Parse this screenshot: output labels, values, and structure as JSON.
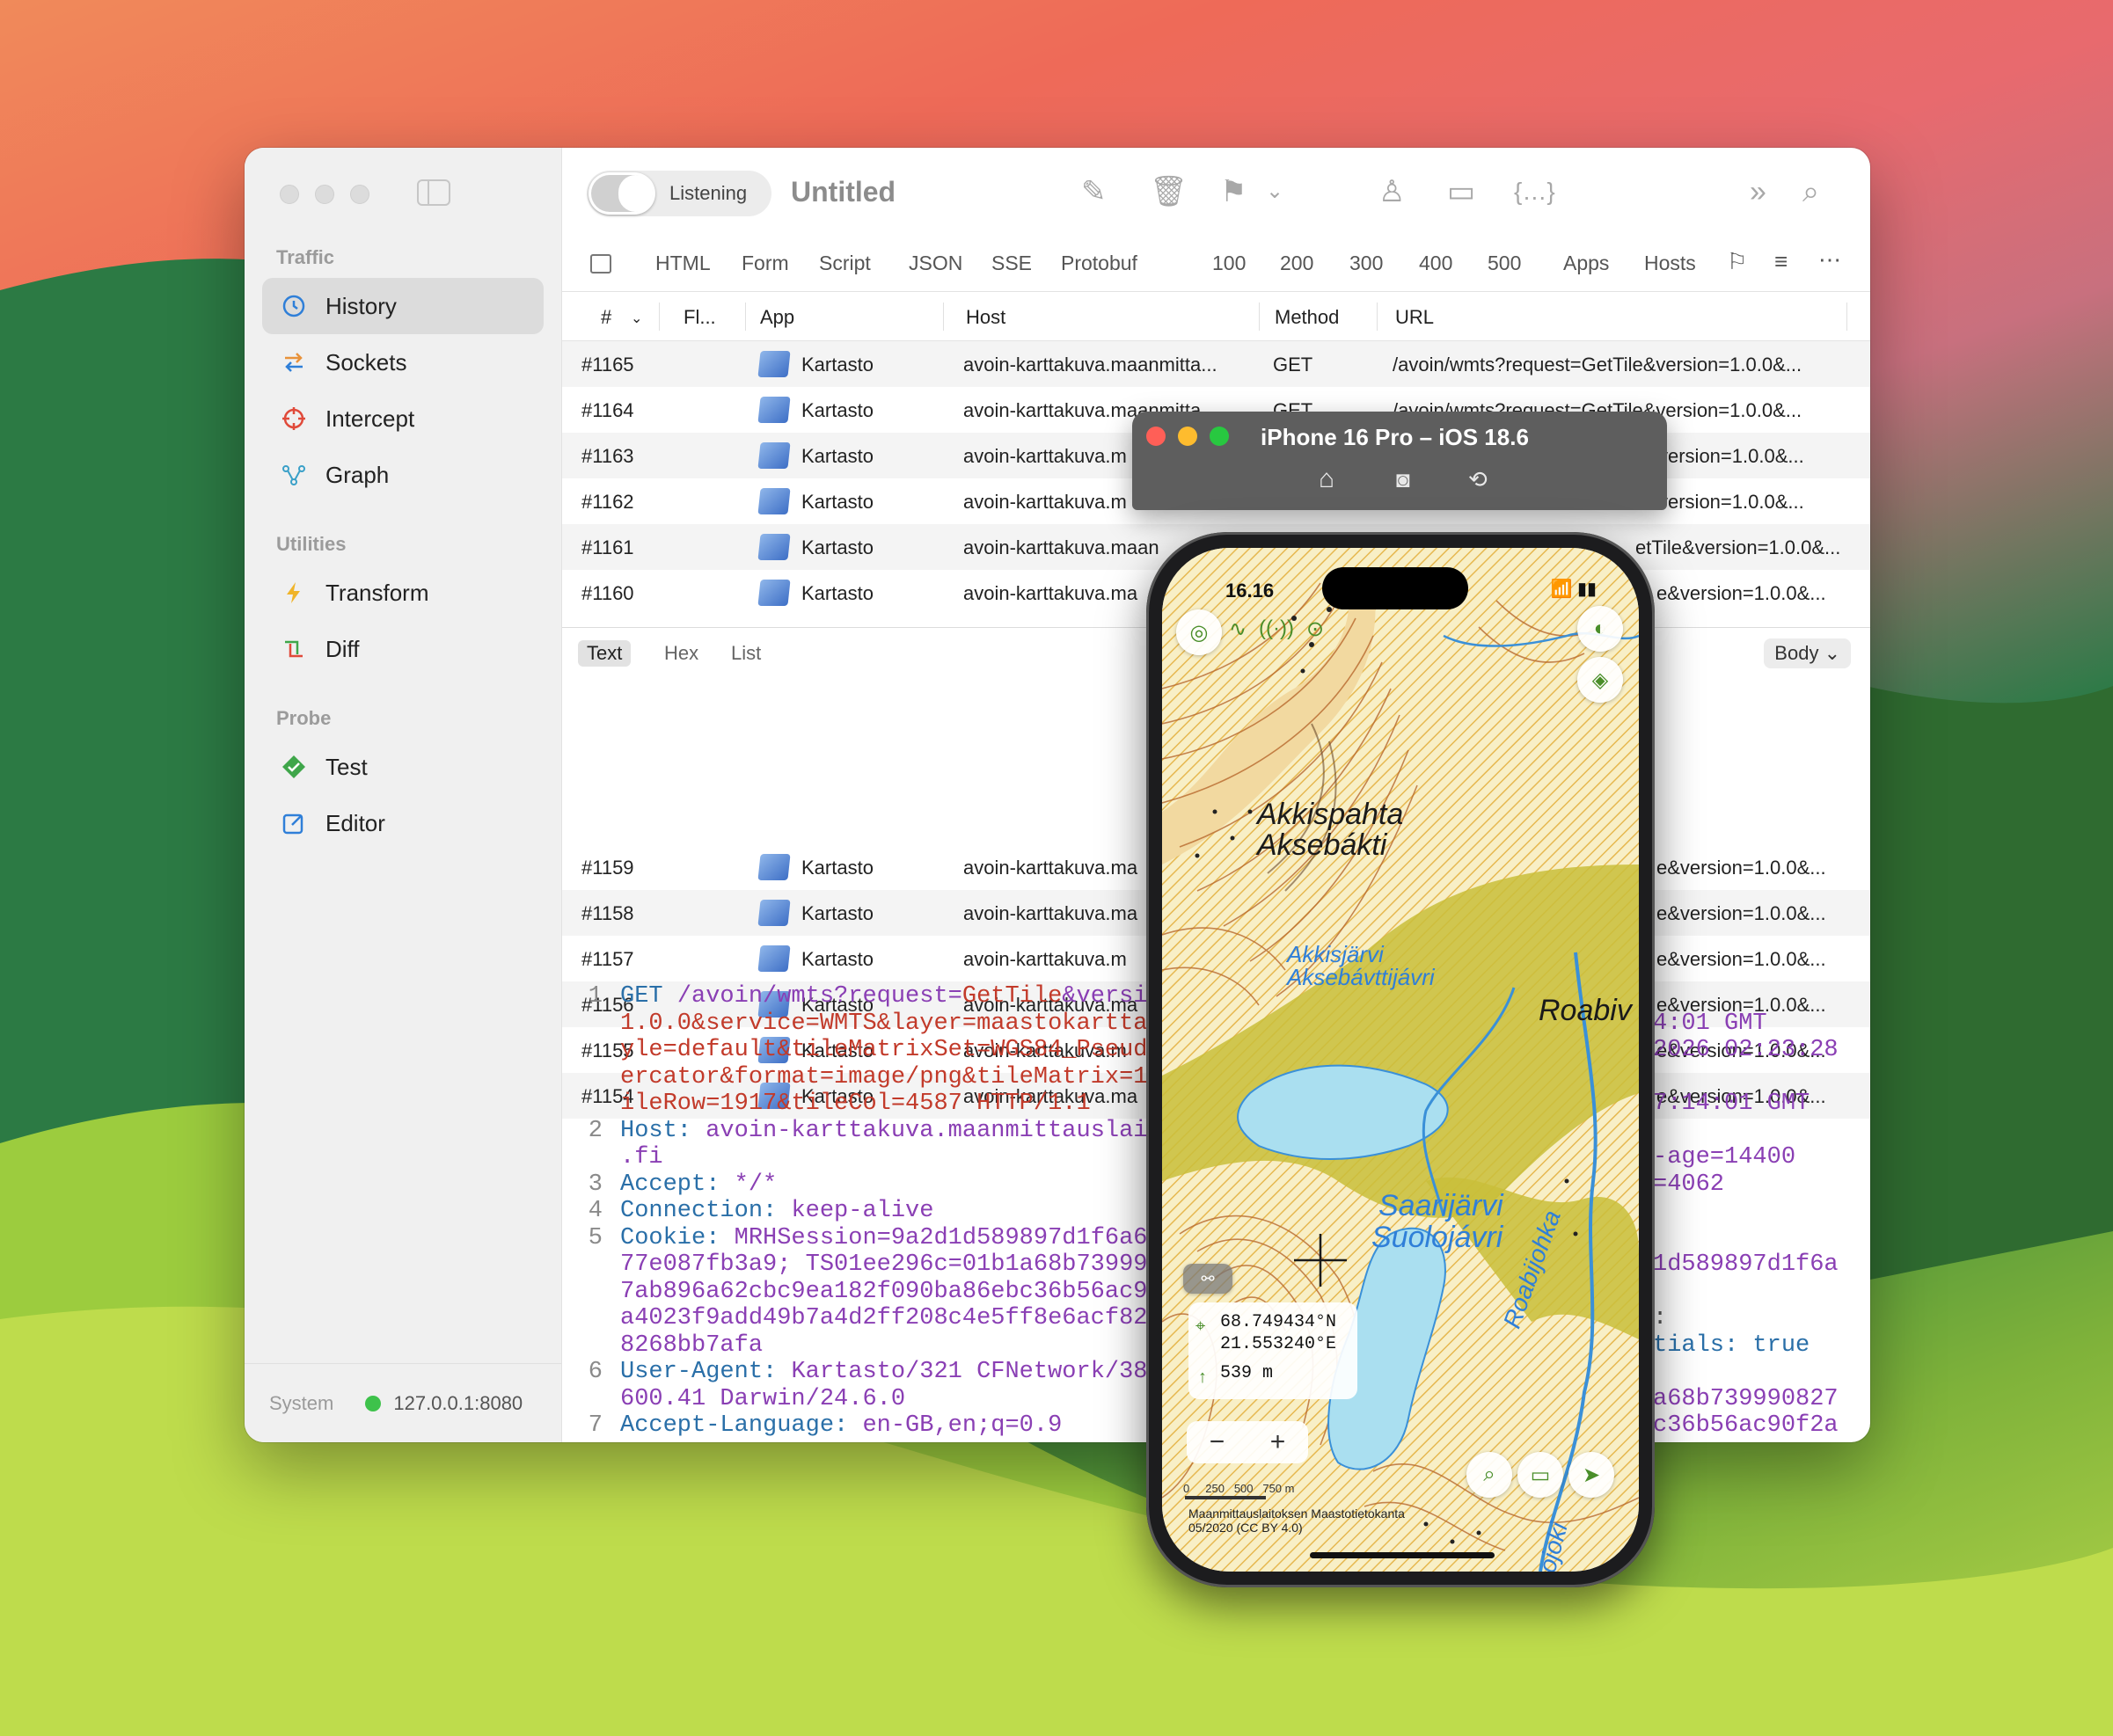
{
  "app": {
    "title": "Untitled",
    "listening_label": "Listening"
  },
  "sidebar": {
    "sections": [
      {
        "label": "Traffic"
      },
      {
        "label": "Utilities"
      },
      {
        "label": "Probe"
      }
    ],
    "items": [
      {
        "label": "History",
        "icon": "clock-icon"
      },
      {
        "label": "Sockets",
        "icon": "arrows-icon"
      },
      {
        "label": "Intercept",
        "icon": "crosshair-icon"
      },
      {
        "label": "Graph",
        "icon": "graph-icon"
      },
      {
        "label": "Transform",
        "icon": "bolt-icon"
      },
      {
        "label": "Diff",
        "icon": "diff-icon"
      },
      {
        "label": "Test",
        "icon": "check-diamond-icon"
      },
      {
        "label": "Editor",
        "icon": "edit-icon"
      }
    ],
    "status": {
      "label": "System",
      "address": "127.0.0.1:8080",
      "color": "#3ec24b"
    }
  },
  "filters": [
    "HTML",
    "Form",
    "Script",
    "JSON",
    "SSE",
    "Protobuf",
    "100",
    "200",
    "300",
    "400",
    "500",
    "Apps",
    "Hosts"
  ],
  "table": {
    "columns": [
      "#",
      "Fl...",
      "App",
      "Host",
      "Method",
      "URL"
    ],
    "rows": [
      {
        "id": "#1165",
        "app": "Kartasto",
        "host": "avoin-karttakuva.maanmitta...",
        "method": "GET",
        "url": "/avoin/wmts?request=GetTile&version=1.0.0&..."
      },
      {
        "id": "#1164",
        "app": "Kartasto",
        "host": "avoin-karttakuva.maanmitta...",
        "method": "GET",
        "url": "/avoin/wmts?request=GetTile&version=1.0.0&..."
      },
      {
        "id": "#1163",
        "app": "Kartasto",
        "host": "avoin-karttakuva.m",
        "method": "",
        "url": "version=1.0.0&..."
      },
      {
        "id": "#1162",
        "app": "Kartasto",
        "host": "avoin-karttakuva.m",
        "method": "",
        "url": "version=1.0.0&..."
      },
      {
        "id": "#1161",
        "app": "Kartasto",
        "host": "avoin-karttakuva.maan",
        "method": "",
        "url": "etTile&version=1.0.0&..."
      },
      {
        "id": "#1160",
        "app": "Kartasto",
        "host": "avoin-karttakuva.ma",
        "method": "",
        "url": "e&version=1.0.0&..."
      },
      {
        "id": "#1159",
        "app": "Kartasto",
        "host": "avoin-karttakuva.ma",
        "method": "",
        "url": "e&version=1.0.0&..."
      },
      {
        "id": "#1158",
        "app": "Kartasto",
        "host": "avoin-karttakuva.ma",
        "method": "",
        "url": "e&version=1.0.0&..."
      },
      {
        "id": "#1157",
        "app": "Kartasto",
        "host": "avoin-karttakuva.m",
        "method": "",
        "url": "e&version=1.0.0&..."
      },
      {
        "id": "#1156",
        "app": "Kartasto",
        "host": "avoin-karttakuva.ma",
        "method": "",
        "url": "e&version=1.0.0&..."
      },
      {
        "id": "#1155",
        "app": "Kartasto",
        "host": "avoin-karttakuva.m",
        "method": "",
        "url": "e&version=1.0.0&..."
      },
      {
        "id": "#1154",
        "app": "Kartasto",
        "host": "avoin-karttakuva.ma",
        "method": "",
        "url": "e&version=1.0.0&..."
      }
    ]
  },
  "detail": {
    "tabs": [
      "Text",
      "Hex",
      "List"
    ],
    "body_selector": "Body",
    "line_numbers": [
      "1",
      "2",
      "3",
      "4",
      "5",
      "6",
      "7"
    ],
    "request_lines": {
      "l1a_method": "GET ",
      "l1a_path": "/avoin/wmts?request=",
      "l1a_val": "GetTile",
      "l1a_rest": "&versi",
      "l1b": "1.0.0&service=WMTS&layer=maastokartta",
      "l1c": "yle=default&tileMatrixSet=WGS84_Pseud",
      "l1d": "ercator&format=image/png&tileMatrix=1",
      "l1e": "ileRow=1917&tileCol=4587 HTTP/1.1",
      "l2a_key": "Host: ",
      "l2a_val": "avoin-karttakuva.maanmittauslai",
      "l2b": ".fi",
      "l3_key": "Accept: ",
      "l3_val": "*/*",
      "l4_key": "Connection: ",
      "l4_val": "keep-alive",
      "l5a_key": "Cookie: ",
      "l5a_val": "MRHSession=9a2d1d589897d1f6a6",
      "l5b": "77e087fb3a9; TS01ee296c=01b1a68b73999",
      "l5c": "7ab896a62cbc9ea182f090ba86ebc36b56ac9",
      "l5d": "a4023f9add49b7a4d2ff208c4e5ff8e6acf82",
      "l5e": "8268bb7afa",
      "l6a_key": "User-Agent: ",
      "l6a_val": "Kartasto/321 CFNetwork/38",
      "l6b": "600.41 Darwin/24.6.0",
      "l7_key": "Accept-Language: ",
      "l7_val": "en-GB,en;q=0.9"
    },
    "response_lines": [
      "4:01 GMT",
      "2026 02:23:28",
      "7:14:01 GMT",
      "-age=14400",
      "=4062",
      "1d589897d1f6a",
      ":",
      "tials: true",
      "a68b739990827",
      "c36b56ac90f2a"
    ]
  },
  "simulator": {
    "title": "iPhone 16 Pro – iOS 18.6",
    "time": "16.16",
    "map_labels": {
      "akkispahta": "Akkispahta",
      "aksebakti": "Aksebákti",
      "akkisjarvi": "Akkisjärvi",
      "aksebavttijavri": "Aksebávttijávri",
      "roabi": "Roabiv",
      "saarijarvi": "Saarijärvi",
      "suolojavri": "Suolojávri",
      "roabijohka": "Roabijohka",
      "joki": "ojoki"
    },
    "coords": {
      "lat": "68.749434°N",
      "lon": "21.553240°E",
      "elev": "539 m"
    },
    "zoom": {
      "minus": "−",
      "plus": "+"
    },
    "scale_labels": "0     250   500   750 m",
    "attribution_1": "Maanmittauslaitoksen Maastotietokanta",
    "attribution_2": "05/2020 (CC BY 4.0)"
  }
}
